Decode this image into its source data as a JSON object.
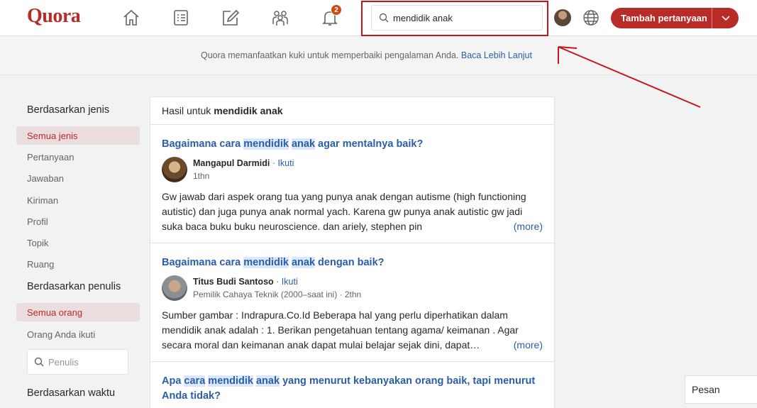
{
  "header": {
    "logo": "Quora",
    "notification_count": "2",
    "search": {
      "value": "mendidik anak"
    },
    "add_question": "Tambah pertanyaan"
  },
  "cookie": {
    "text": "Quora memanfaatkan kuki untuk memperbaiki pengalaman Anda.",
    "link": "Baca Lebih Lanjut"
  },
  "sidebar": {
    "type_heading": "Berdasarkan jenis",
    "types": [
      "Semua jenis",
      "Pertanyaan",
      "Jawaban",
      "Kiriman",
      "Profil",
      "Topik",
      "Ruang"
    ],
    "author_heading": "Berdasarkan penulis",
    "authors": [
      "Semua orang",
      "Orang Anda ikuti"
    ],
    "author_placeholder": "Penulis",
    "time_heading": "Berdasarkan waktu"
  },
  "results": {
    "heading_prefix": "Hasil untuk",
    "query": "mendidik anak",
    "items": [
      {
        "title_parts": [
          "Bagaimana cara ",
          "mendidik",
          " ",
          "anak",
          " agar mentalnya baik?"
        ],
        "author": "Mangapul Darmidi",
        "follow": "· Ikuti",
        "sub": "1thn",
        "snippet": "Gw jawab dari aspek orang tua yang punya anak dengan autisme (high functioning autistic) dan juga punya anak normal yach. Karena gw punya anak autistic gw jadi suka baca buku buku neuroscience. dan ariely, stephen pin",
        "more": "(more)"
      },
      {
        "title_parts": [
          "Bagaimana cara ",
          "mendidik",
          " ",
          "anak",
          " dengan baik?"
        ],
        "author": "Titus Budi Santoso",
        "follow": "· Ikuti",
        "sub": "Pemilik Cahaya Teknik (2000–saat ini) · 2thn",
        "snippet": "Sumber gambar : Indrapura.Co.Id Beberapa hal yang perlu diperhatikan dalam mendidik anak adalah : 1. Berikan pengetahuan tentang agama/ keimanan . Agar secara moral dan keimanan anak dapat mulai belajar sejak dini, dapat…",
        "more": "(more)"
      },
      {
        "title_parts": [
          "Apa ",
          "cara",
          " ",
          "mendidik",
          " ",
          "anak",
          " yang menurut kebanyakan orang baik, tapi menurut Anda tidak?"
        ]
      }
    ]
  },
  "messages": {
    "label": "Pesan"
  }
}
